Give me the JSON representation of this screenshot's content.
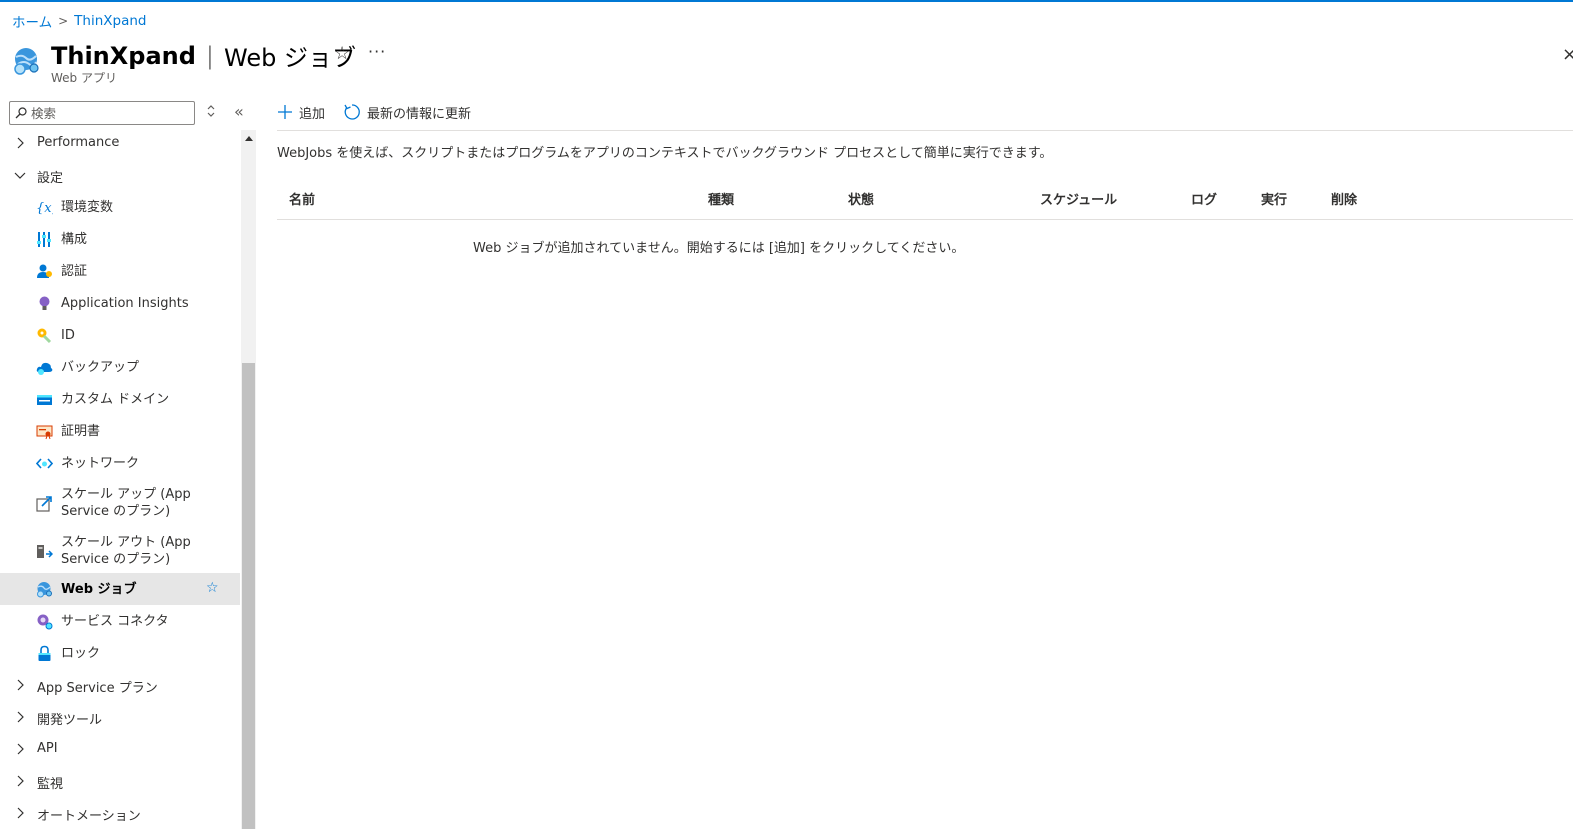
{
  "breadcrumb": {
    "home": "ホーム",
    "current": "ThinXpand"
  },
  "header": {
    "resource_name": "ThinXpand",
    "separator": "|",
    "page_name": "Web ジョブ",
    "subtitle": "Web アプリ",
    "favorite_icon": "star-icon",
    "more_label": "···",
    "close_label": "×"
  },
  "sidebar": {
    "search_placeholder": "検索",
    "collapse_label": "«",
    "items": [
      {
        "type": "group",
        "label": "Performance",
        "expanded": false
      },
      {
        "type": "group",
        "label": "設定",
        "expanded": true
      },
      {
        "type": "child",
        "label": "環境変数",
        "icon": "variable-icon"
      },
      {
        "type": "child",
        "label": "構成",
        "icon": "configuration-icon"
      },
      {
        "type": "child",
        "label": "認証",
        "icon": "authentication-icon"
      },
      {
        "type": "child",
        "label": "Application Insights",
        "icon": "lightbulb-icon"
      },
      {
        "type": "child",
        "label": "ID",
        "icon": "identity-key-icon"
      },
      {
        "type": "child",
        "label": "バックアップ",
        "icon": "cloud-backup-icon"
      },
      {
        "type": "child",
        "label": "カスタム ドメイン",
        "icon": "custom-domain-icon"
      },
      {
        "type": "child",
        "label": "証明書",
        "icon": "certificate-icon"
      },
      {
        "type": "child",
        "label": "ネットワーク",
        "icon": "network-icon"
      },
      {
        "type": "child",
        "label": "スケール アップ (App Service のプラン)",
        "icon": "scale-up-icon"
      },
      {
        "type": "child",
        "label": "スケール アウト (App Service のプラン)",
        "icon": "scale-out-icon"
      },
      {
        "type": "child",
        "label": "Web ジョブ",
        "icon": "webjobs-icon",
        "active": true
      },
      {
        "type": "child",
        "label": "サービス コネクタ",
        "icon": "service-connector-icon"
      },
      {
        "type": "child",
        "label": "ロック",
        "icon": "lock-icon"
      },
      {
        "type": "group",
        "label": "App Service プラン",
        "expanded": false
      },
      {
        "type": "group",
        "label": "開発ツール",
        "expanded": false
      },
      {
        "type": "group",
        "label": "API",
        "expanded": false
      },
      {
        "type": "group",
        "label": "監視",
        "expanded": false
      },
      {
        "type": "group",
        "label": "オートメーション",
        "expanded": false
      }
    ]
  },
  "toolbar": {
    "add_label": "追加",
    "refresh_label": "最新の情報に更新"
  },
  "main": {
    "description": "WebJobs を使えば、スクリプトまたはプログラムをアプリのコンテキストでバックグラウンド プロセスとして簡単に実行できます。",
    "columns": [
      "名前",
      "種類",
      "状態",
      "スケジュール",
      "ログ",
      "実行",
      "削除"
    ],
    "empty_message": "Web ジョブが追加されていません。開始するには [追加] をクリックしてください。"
  },
  "colors": {
    "accent": "#0078d4",
    "active_bg": "#e6e6e6"
  }
}
